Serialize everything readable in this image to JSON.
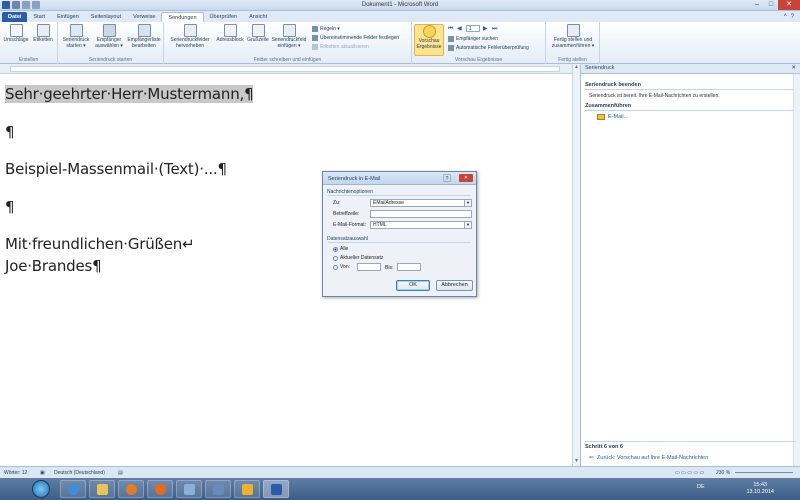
{
  "window": {
    "title": "Dokument1 - Microsoft Word",
    "buttons": {
      "minimize": "–",
      "maximize": "□",
      "close": "✕"
    }
  },
  "tabs": [
    "Datei",
    "Start",
    "Einfügen",
    "Seitenlayout",
    "Verweise",
    "Sendungen",
    "Überprüfen",
    "Ansicht"
  ],
  "ribbon": {
    "groups": {
      "erstellen": "Erstellen",
      "seriendruck_starten": "Seriendruck starten",
      "felder": "Felder schreiben und einfügen",
      "vorschau": "Vorschau Ergebnisse",
      "fertigstellen": "Fertig stellen"
    },
    "buttons": {
      "umschlaege": "Umschläge",
      "etiketten": "Etiketten",
      "seriendruck_starten": "Seriendruck starten ▾",
      "empfaenger_auswaehlen": "Empfänger auswählen ▾",
      "empfaengerliste_bearbeiten": "Empfängerliste bearbeiten",
      "seriendruckfelder_hervorheben": "Seriendruckfelder hervorheben",
      "adressblock": "Adressblock",
      "grusszeile": "Grußzeile",
      "seriendruckfeld_einfuegen": "Seriendruckfeld einfügen ▾",
      "regeln": "Regeln ▾",
      "uebereinstimmende_felder": "Übereinstimmende Felder festlegen",
      "etiketten_aktualisieren": "Etiketten aktualisieren",
      "vorschau_ergebnisse": "Vorschau Ergebnisse",
      "record_number": "1",
      "empfaenger_suchen": "Empfänger suchen",
      "fehlerueberpruefung": "Automatische Fehlerüberprüfung",
      "fertig_stellen": "Fertig stellen und zusammenführen ▾"
    }
  },
  "document": {
    "paragraphs": [
      "Sehr·geehrter·Herr·Mustermann,¶",
      "¶",
      "Beispiel-Massenmail·(Text)·...¶",
      "¶",
      "Mit·freundlichen·Grüßen↵",
      "Joe·Brandes¶"
    ]
  },
  "task_pane": {
    "title": "Seriendruck",
    "close": "✕",
    "section1_heading": "Seriendruck beenden",
    "section1_text": "Seriendruck ist bereit. Ihre E-Mail-Nachrichten zu erstellen.",
    "section2_heading": "Zusammenführen",
    "email_link": "E-Mail...",
    "step_text": "Schritt 6 von 6",
    "back_link": "Zurück: Vorschau auf Ihre E-Mail-Nachrichten"
  },
  "dialog": {
    "title": "Seriendruck in E-Mail",
    "help": "?",
    "close": "✕",
    "section_options": "Nachrichtenoptionen",
    "label_to": "Zu:",
    "value_to": "EMailAdresse",
    "label_subject": "Betreffzeile:",
    "value_subject": "",
    "label_format": "E-Mail-Format:",
    "value_format": "HTML",
    "section_records": "Datensatzauswahl",
    "radio_all": "Alle",
    "radio_current": "Aktueller Datensatz",
    "radio_from": "Von:",
    "label_to_record": "Bis:",
    "ok": "OK",
    "cancel": "Abbrechen"
  },
  "status_bar": {
    "words": "Wörter: 12",
    "language": "Deutsch (Deutschland)",
    "zoom": "230 %"
  },
  "taskbar": {
    "language": "DE",
    "time": "15:43",
    "date": "13.10.2014"
  },
  "colors": {
    "accent": "#2a5ca8",
    "selection": "#c8c8c8",
    "highlight": "#fde48e"
  }
}
